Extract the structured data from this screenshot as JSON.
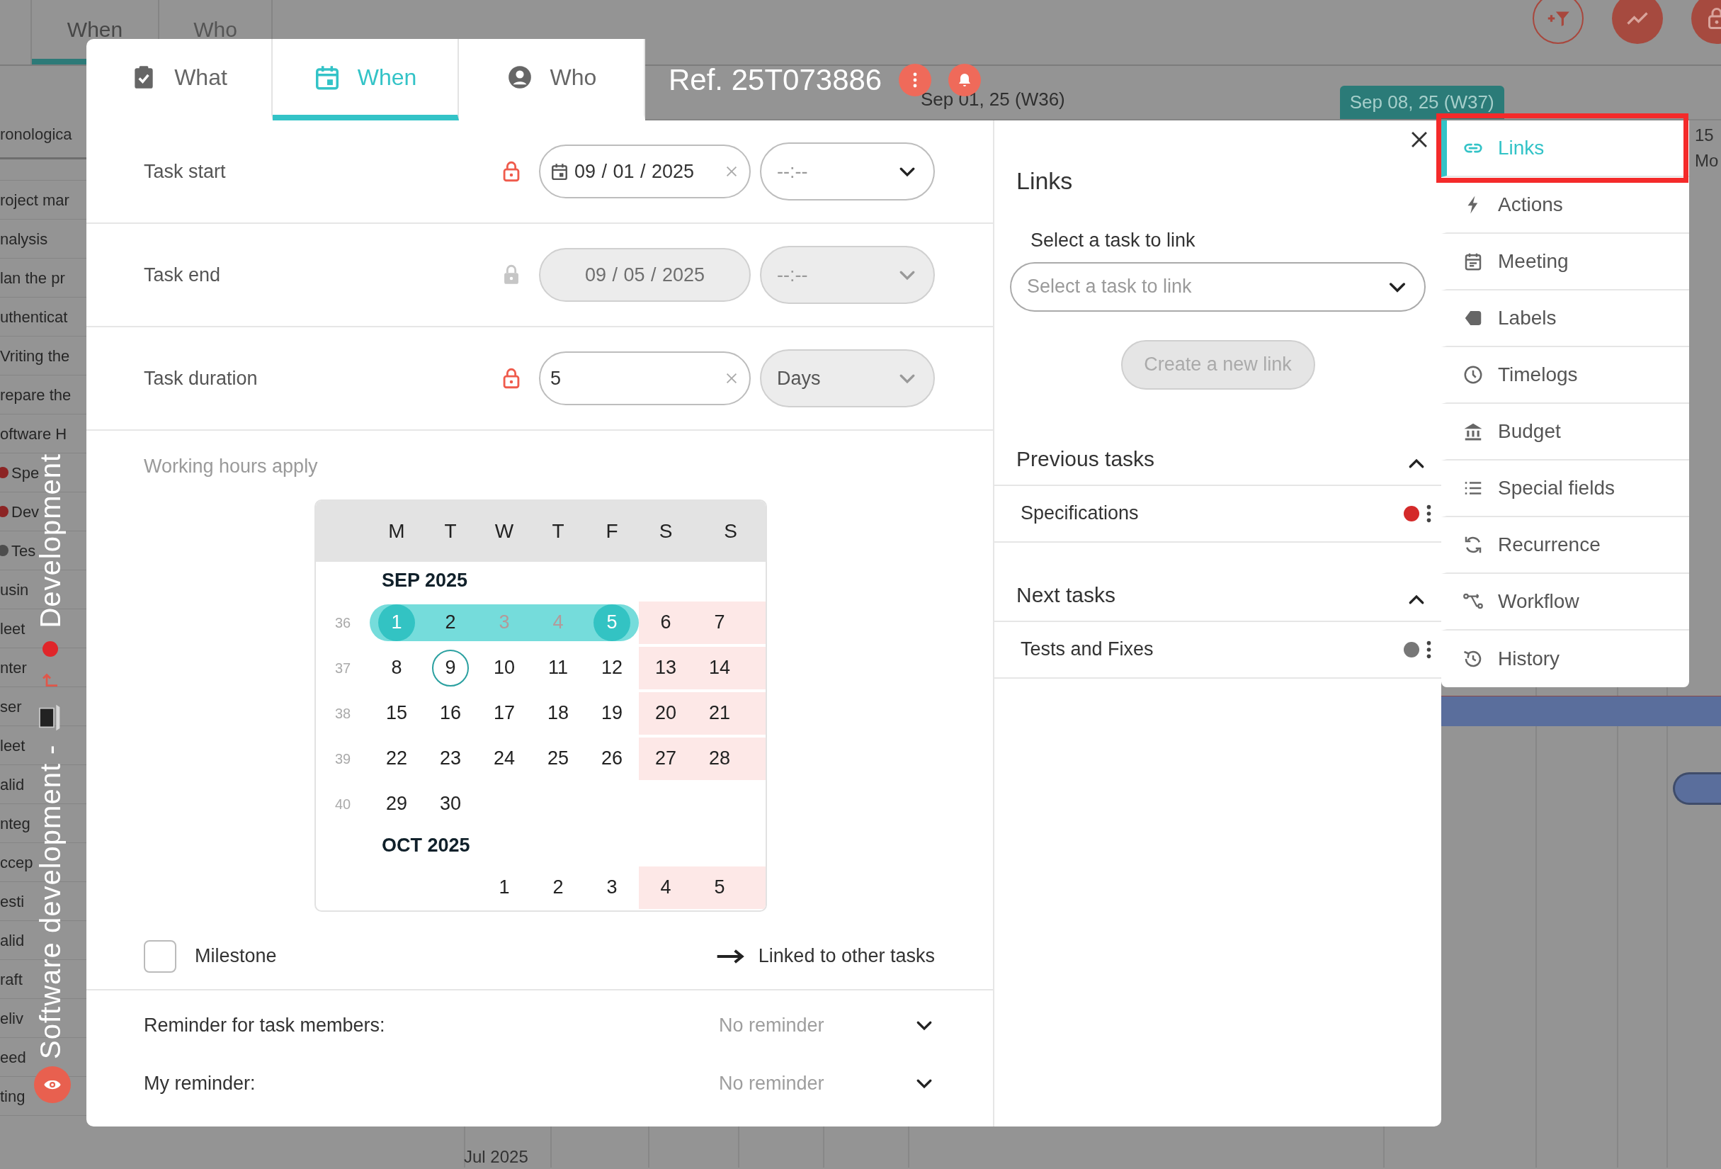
{
  "background": {
    "top_tabs": [
      {
        "label": "When",
        "selected": true
      },
      {
        "label": "Who",
        "selected": false
      }
    ],
    "week_headers": [
      {
        "label": "Sep 01, 25 (W36)",
        "selected": false
      },
      {
        "label": "Sep 08, 25 (W37)",
        "selected": true
      }
    ],
    "day_header": [
      "15",
      "Mo"
    ],
    "column_header": "ronologica",
    "task_rows": [
      {
        "label": "roject mar"
      },
      {
        "label": "nalysis"
      },
      {
        "label": "lan the pr"
      },
      {
        "label": "uthenticat"
      },
      {
        "label": "Vriting the"
      },
      {
        "label": "repare the"
      },
      {
        "label": "oftware H"
      },
      {
        "label": "Spe",
        "color": "#8c2424"
      },
      {
        "label": "Dev",
        "color": "#8c2424"
      },
      {
        "label": "Tes",
        "color": "#4d4d4d"
      },
      {
        "label": "usin"
      },
      {
        "label": "leet"
      },
      {
        "label": "nter"
      },
      {
        "label": "ser"
      },
      {
        "label": "leet"
      },
      {
        "label": "alid"
      },
      {
        "label": "nteg"
      },
      {
        "label": "ccep"
      },
      {
        "label": "esti"
      },
      {
        "label": "alid"
      },
      {
        "label": "raft"
      },
      {
        "label": "eliv"
      },
      {
        "label": "eed"
      },
      {
        "label": "ting"
      }
    ],
    "group_label": [
      "Software development -",
      "Development"
    ],
    "timeline_label": "Jul 2025"
  },
  "dialog": {
    "tabs": [
      {
        "label": "What",
        "kind": "clipboard",
        "selected": false
      },
      {
        "label": "When",
        "kind": "calendar",
        "selected": true
      },
      {
        "label": "Who",
        "kind": "person",
        "selected": false
      }
    ],
    "ref": "Ref. 25T073886",
    "fields": [
      {
        "label": "Task start",
        "locked": true,
        "disabled": false,
        "kind": "date",
        "value": "09 / 01 / 2025",
        "clearable": true,
        "select": {
          "placeholder": "--:--",
          "disabled": false
        }
      },
      {
        "label": "Task end",
        "locked": false,
        "disabled": true,
        "kind": "date",
        "value": "09 / 05 / 2025",
        "clearable": false,
        "select": {
          "placeholder": "--:--",
          "disabled": true
        }
      },
      {
        "label": "Task duration",
        "locked": true,
        "disabled": false,
        "kind": "number",
        "value": "5",
        "clearable": true,
        "select": {
          "value": "Days",
          "disabled": true
        }
      }
    ],
    "working_hours": "Working hours apply",
    "calendar": {
      "weekdays": [
        "M",
        "T",
        "W",
        "T",
        "F",
        "S",
        "S"
      ],
      "months": [
        {
          "label": "SEP 2025",
          "weeks": [
            {
              "number": "36",
              "days": [
                {
                  "label": "1",
                  "kind": "range-start"
                },
                {
                  "label": "2",
                  "kind": "range"
                },
                {
                  "label": "3",
                  "kind": "range-off"
                },
                {
                  "label": "4",
                  "kind": "range-off"
                },
                {
                  "label": "5",
                  "kind": "range-end"
                },
                {
                  "label": "6",
                  "kind": "weekend"
                },
                {
                  "label": "7",
                  "kind": "weekend"
                }
              ]
            },
            {
              "number": "37",
              "days": [
                {
                  "label": "8",
                  "kind": "day"
                },
                {
                  "label": "9",
                  "kind": "today"
                },
                {
                  "label": "10",
                  "kind": "day"
                },
                {
                  "label": "11",
                  "kind": "day"
                },
                {
                  "label": "12",
                  "kind": "day"
                },
                {
                  "label": "13",
                  "kind": "weekend"
                },
                {
                  "label": "14",
                  "kind": "weekend"
                }
              ]
            },
            {
              "number": "38",
              "days": [
                {
                  "label": "15",
                  "kind": "day"
                },
                {
                  "label": "16",
                  "kind": "day"
                },
                {
                  "label": "17",
                  "kind": "day"
                },
                {
                  "label": "18",
                  "kind": "day"
                },
                {
                  "label": "19",
                  "kind": "day"
                },
                {
                  "label": "20",
                  "kind": "weekend"
                },
                {
                  "label": "21",
                  "kind": "weekend"
                }
              ]
            },
            {
              "number": "39",
              "days": [
                {
                  "label": "22",
                  "kind": "day"
                },
                {
                  "label": "23",
                  "kind": "day"
                },
                {
                  "label": "24",
                  "kind": "day"
                },
                {
                  "label": "25",
                  "kind": "day"
                },
                {
                  "label": "26",
                  "kind": "day"
                },
                {
                  "label": "27",
                  "kind": "weekend"
                },
                {
                  "label": "28",
                  "kind": "weekend"
                }
              ]
            },
            {
              "number": "40",
              "days": [
                {
                  "label": "29",
                  "kind": "day"
                },
                {
                  "label": "30",
                  "kind": "day"
                }
              ]
            }
          ]
        },
        {
          "label": "OCT 2025",
          "weeks": [
            {
              "days": [
                {
                  "kind": "blank"
                },
                {
                  "kind": "blank"
                },
                {
                  "label": "1",
                  "kind": "day"
                },
                {
                  "label": "2",
                  "kind": "day"
                },
                {
                  "label": "3",
                  "kind": "day"
                },
                {
                  "label": "4",
                  "kind": "weekend"
                },
                {
                  "label": "5",
                  "kind": "weekend"
                }
              ]
            }
          ]
        }
      ]
    },
    "milestone": {
      "label": "Milestone",
      "checked": false
    },
    "linked": "Linked to other tasks",
    "reminders": [
      {
        "label": "Reminder for task members:",
        "value": "No reminder"
      },
      {
        "label": "My reminder:",
        "value": "No reminder"
      }
    ],
    "links": {
      "title": "Links",
      "select_label": "Select a task to link",
      "select_placeholder": "Select a task to link",
      "create_button": {
        "label": "Create a new link",
        "disabled": true
      },
      "sections": [
        {
          "title": "Previous tasks",
          "expanded": true,
          "tasks": [
            {
              "name": "Specifications",
              "color": "#d42a2a"
            }
          ]
        },
        {
          "title": "Next tasks",
          "expanded": true,
          "tasks": [
            {
              "name": "Tests and Fixes",
              "color": "#777777"
            }
          ]
        }
      ]
    },
    "side_menu": [
      {
        "label": "Links",
        "kind": "link",
        "selected": true
      },
      {
        "label": "Actions",
        "kind": "bolt",
        "selected": false
      },
      {
        "label": "Meeting",
        "kind": "meeting",
        "selected": false
      },
      {
        "label": "Labels",
        "kind": "tag",
        "selected": false
      },
      {
        "label": "Timelogs",
        "kind": "clock",
        "selected": false
      },
      {
        "label": "Budget",
        "kind": "bank",
        "selected": false
      },
      {
        "label": "Special fields",
        "kind": "list",
        "selected": false
      },
      {
        "label": "Recurrence",
        "kind": "sync",
        "selected": false
      },
      {
        "label": "Workflow",
        "kind": "workflow",
        "selected": false
      },
      {
        "label": "History",
        "kind": "history",
        "selected": false
      }
    ]
  }
}
